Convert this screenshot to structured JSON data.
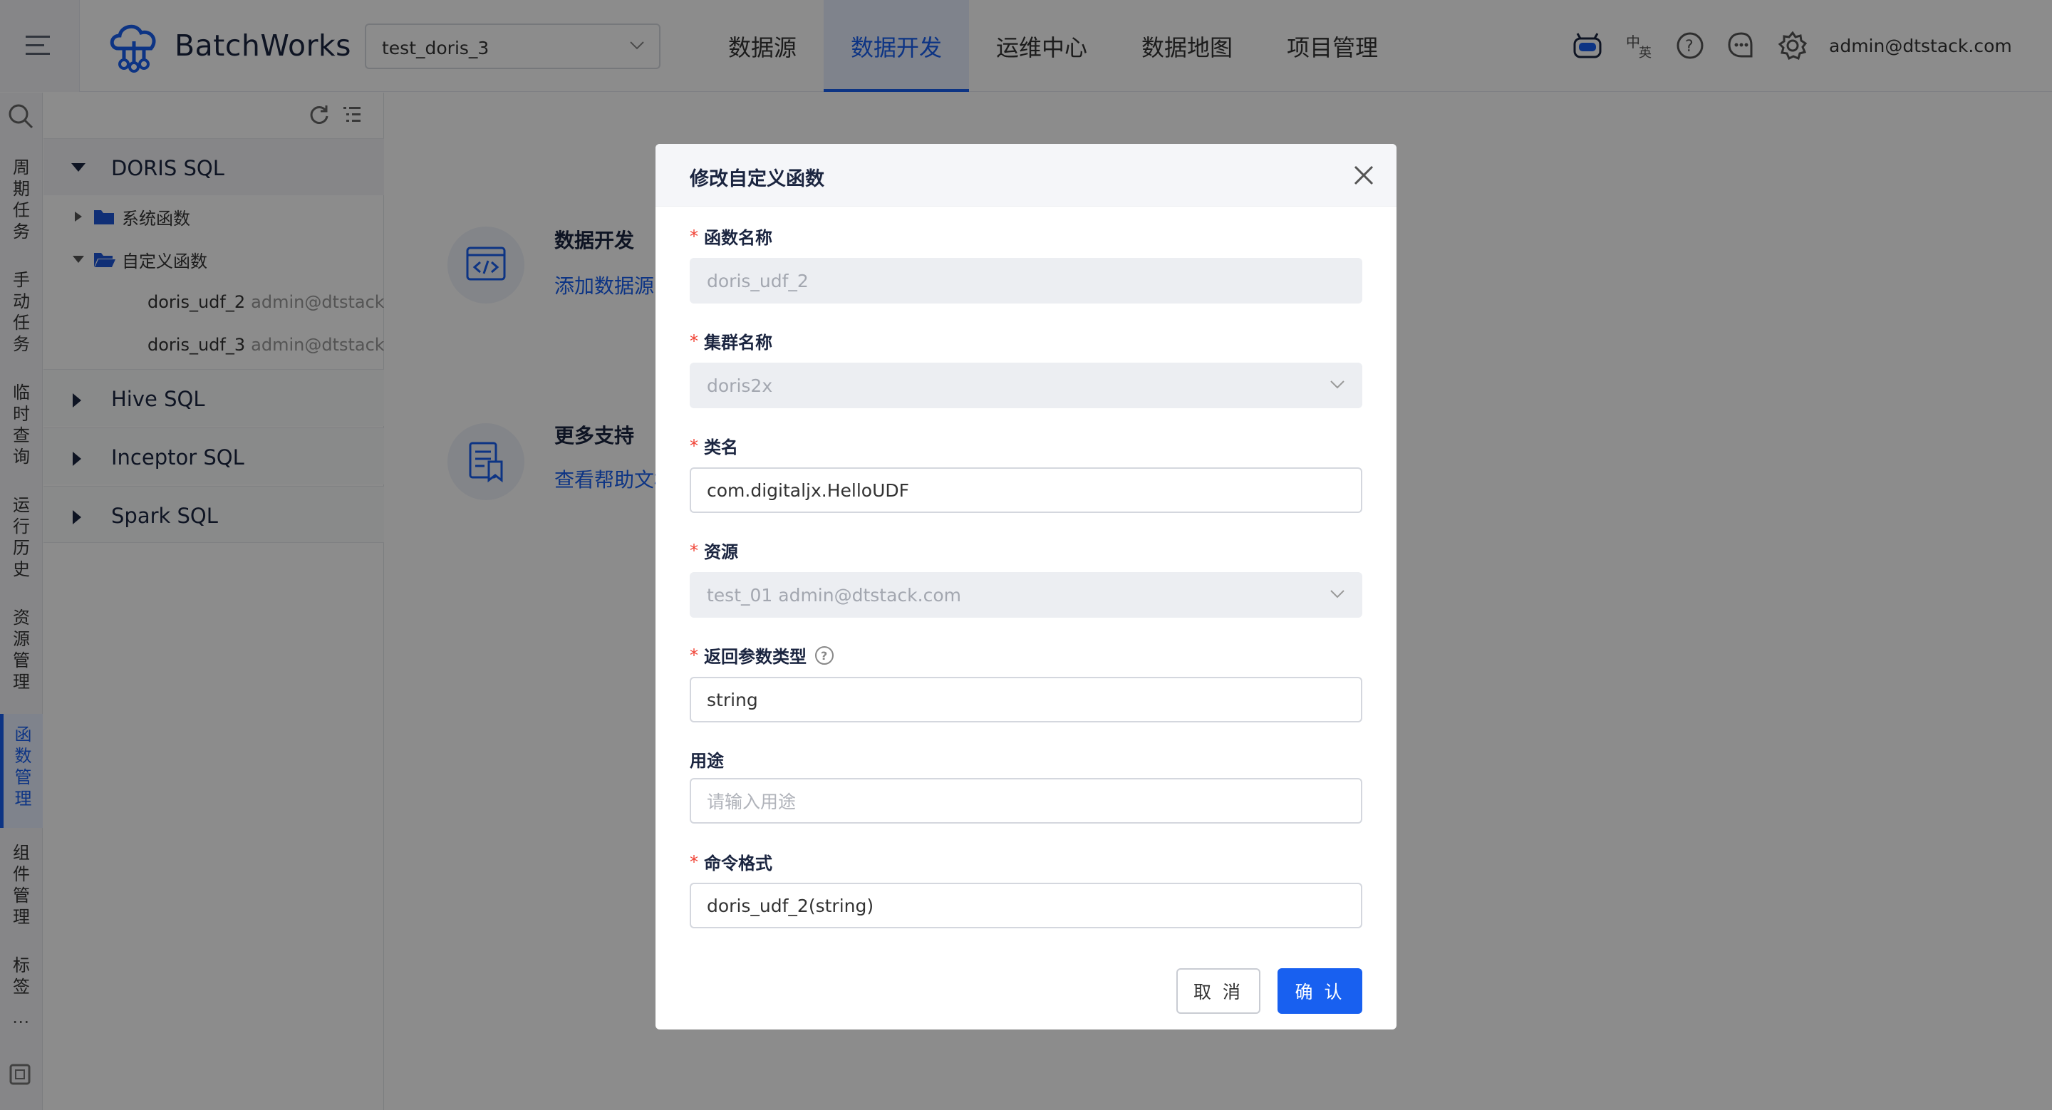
{
  "app": {
    "brand": "BatchWorks",
    "project": "test_doris_3",
    "user": "admin@dtstack.com"
  },
  "nav": [
    "数据源",
    "数据开发",
    "运维中心",
    "数据地图",
    "项目管理"
  ],
  "tool_icons": [
    "robot-icon",
    "language-icon",
    "help-icon",
    "message-icon",
    "settings-icon"
  ],
  "rail": [
    "周期任务",
    "手动任务",
    "临时查询",
    "运行历史",
    "资源管理",
    "函数管理",
    "组件管理",
    "标签"
  ],
  "rail_active": "函数管理",
  "tree": {
    "categories": [
      "DORIS SQL",
      "Hive SQL",
      "Inceptor SQL",
      "Spark SQL"
    ],
    "system_folder": "系统函数",
    "custom_folder": "自定义函数",
    "items": [
      {
        "name": "doris_udf_2",
        "owner": "admin@dtstack.com"
      },
      {
        "name": "doris_udf_3",
        "owner": "admin@dtstack.com"
      }
    ]
  },
  "main": {
    "dev_title": "数据开发",
    "dev_link": "添加数据源",
    "support_title": "更多支持",
    "support_link": "查看帮助文档"
  },
  "modal": {
    "title": "修改自定义函数",
    "fields": {
      "func_name": {
        "label": "函数名称",
        "value": "doris_udf_2"
      },
      "cluster": {
        "label": "集群名称",
        "value": "doris2x"
      },
      "class_name": {
        "label": "类名",
        "value": "com.digitaljx.HelloUDF"
      },
      "resource": {
        "label": "资源",
        "value": "test_01 admin@dtstack.com"
      },
      "return_type": {
        "label": "返回参数类型",
        "value": "string"
      },
      "purpose": {
        "label": "用途",
        "placeholder": "请输入用途"
      },
      "command": {
        "label": "命令格式",
        "value": "doris_udf_2(string)"
      }
    },
    "cancel": "取 消",
    "confirm": "确 认"
  },
  "colors": {
    "primary": "#1860f0",
    "required": "#f04134",
    "mask": "rgba(0,0,0,0.45)"
  }
}
